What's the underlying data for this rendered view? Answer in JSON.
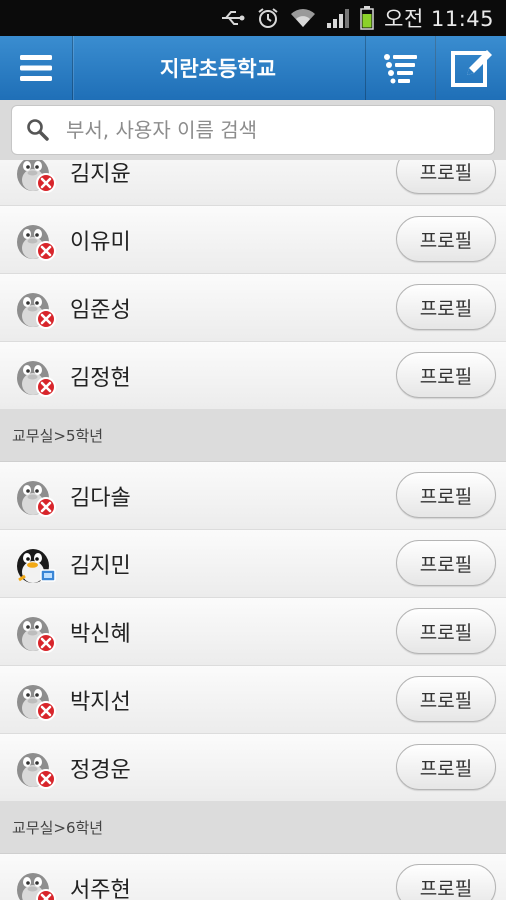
{
  "status_bar": {
    "time": "11:45",
    "ampm": "오전",
    "icons": [
      "usb-icon",
      "alarm-icon",
      "wifi-icon",
      "signal-icon",
      "battery-icon"
    ]
  },
  "app_bar": {
    "title": "지란초등학교",
    "icons": [
      "menu-icon",
      "list-icon",
      "compose-icon"
    ]
  },
  "search": {
    "placeholder": "부서, 사용자 이름 검색"
  },
  "profile_label": "프로필",
  "rows_top": [
    {
      "name": "김지윤",
      "online": false
    },
    {
      "name": "이유미",
      "online": false
    },
    {
      "name": "임준성",
      "online": false
    },
    {
      "name": "김정현",
      "online": false
    }
  ],
  "group1": {
    "label": "교무실>5학년"
  },
  "rows_g1": [
    {
      "name": "김다솔",
      "online": false
    },
    {
      "name": "김지민",
      "online": true
    },
    {
      "name": "박신혜",
      "online": false
    },
    {
      "name": "박지선",
      "online": false
    },
    {
      "name": "정경운",
      "online": false
    }
  ],
  "group2": {
    "label": "교무실>6학년"
  },
  "rows_g2": [
    {
      "name": "서주현",
      "online": false
    }
  ],
  "colors": {
    "app_bar": "#2a7cc2",
    "status_bar": "#0b0b0b",
    "offline_badge": "#d8252b"
  }
}
